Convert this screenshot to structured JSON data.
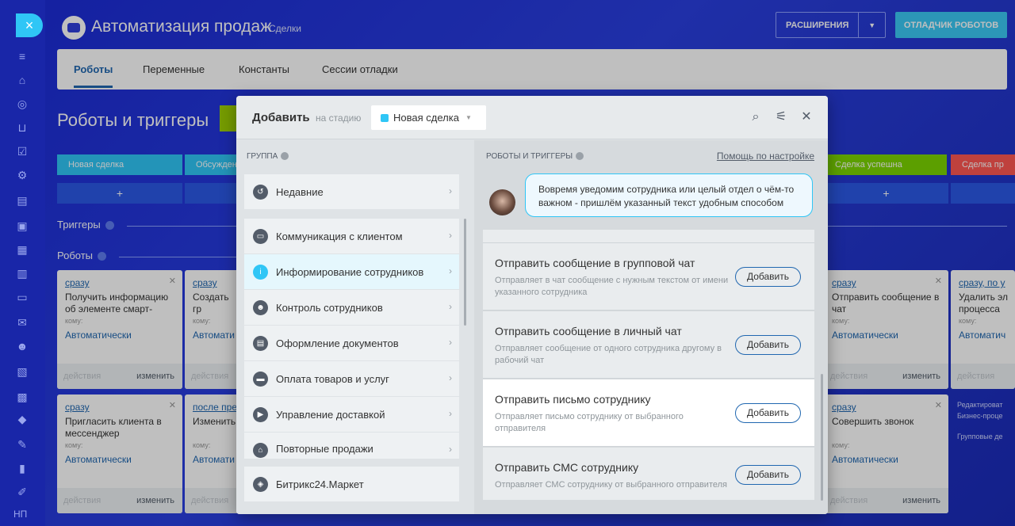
{
  "header": {
    "title": "Автоматизация продаж",
    "subtitle": "Сделки",
    "extensions": "РАСШИРЕНИЯ",
    "debugger": "ОТЛАДЧИК РОБОТОВ"
  },
  "tabs": [
    "Роботы",
    "Переменные",
    "Константы",
    "Сессии отладки"
  ],
  "page_title": "Роботы и триггеры",
  "stages": [
    "Новая сделка",
    "Обсужден",
    "Сделка успешна",
    "Сделка пр"
  ],
  "plus": "+",
  "sections": {
    "triggers": "Триггеры",
    "robots": "Роботы"
  },
  "cards": [
    {
      "when": "сразу",
      "name": "Получить информацию об элементе смарт-",
      "komu": "кому:",
      "auto": "Автоматически",
      "act": "действия",
      "chg": "изменить"
    },
    {
      "when": "сразу",
      "name": "Создать гр",
      "komu": "кому:",
      "auto": "Автомати",
      "act": "действия",
      "chg": ""
    },
    {
      "when": "сразу",
      "name": "Отправить сообщение в чат",
      "komu": "кому:",
      "auto": "Автоматически",
      "act": "действия",
      "chg": "изменить"
    },
    {
      "when": "сразу, по у",
      "name": "Удалить эл процесса",
      "komu": "кому:",
      "auto": "Автоматич",
      "act": "действия",
      "chg": ""
    },
    {
      "when": "сразу",
      "name": "Пригласить клиента в мессенджер",
      "komu": "кому:",
      "auto": "Автоматически",
      "act": "действия",
      "chg": "изменить"
    },
    {
      "when": "после пре",
      "name": "Изменить",
      "komu": "кому:",
      "auto": "Автомати",
      "act": "действия",
      "chg": ""
    },
    {
      "when": "сразу",
      "name": "Совершить звонок",
      "komu": "кому:",
      "auto": "Автоматически",
      "act": "действия",
      "chg": "изменить"
    }
  ],
  "side_note": {
    "l1": "Редактироват",
    "l2": "Бизнес-проце",
    "l3": "Групповые де"
  },
  "modal": {
    "add": "Добавить",
    "at_stage": "на стадию",
    "stage": "Новая сделка",
    "group_title": "ГРУППА",
    "right_title": "РОБОТЫ И ТРИГГЕРЫ",
    "help": "Помощь по настройке",
    "bubble": "Вовремя уведомим сотрудника или целый отдел о чём-то важном - пришлём указанный текст удобным способом",
    "groups": [
      "Недавние",
      "Коммуникация с клиентом",
      "Информирование сотрудников",
      "Контроль сотрудников",
      "Оформление документов",
      "Оплата товаров и услуг",
      "Управление доставкой",
      "Повторные продажи",
      "Битрикс24.Маркет"
    ],
    "items": [
      {
        "title": "Отправить сообщение в групповой чат",
        "desc": "Отправляет в чат сообщение с нужным текстом от имени указанного сотрудника",
        "btn": "Добавить"
      },
      {
        "title": "Отправить сообщение в личный чат",
        "desc": "Отправляет сообщение от одного сотрудника другому в рабочий чат",
        "btn": "Добавить"
      },
      {
        "title": "Отправить письмо сотруднику",
        "desc": "Отправляет письмо сотруднику от выбранного отправителя",
        "btn": "Добавить"
      },
      {
        "title": "Отправить СМС сотруднику",
        "desc": "Отправляет СМС сотруднику от выбранного отправителя",
        "btn": "Добавить"
      }
    ]
  },
  "rail": {
    "close": "×",
    "user": "НП"
  }
}
